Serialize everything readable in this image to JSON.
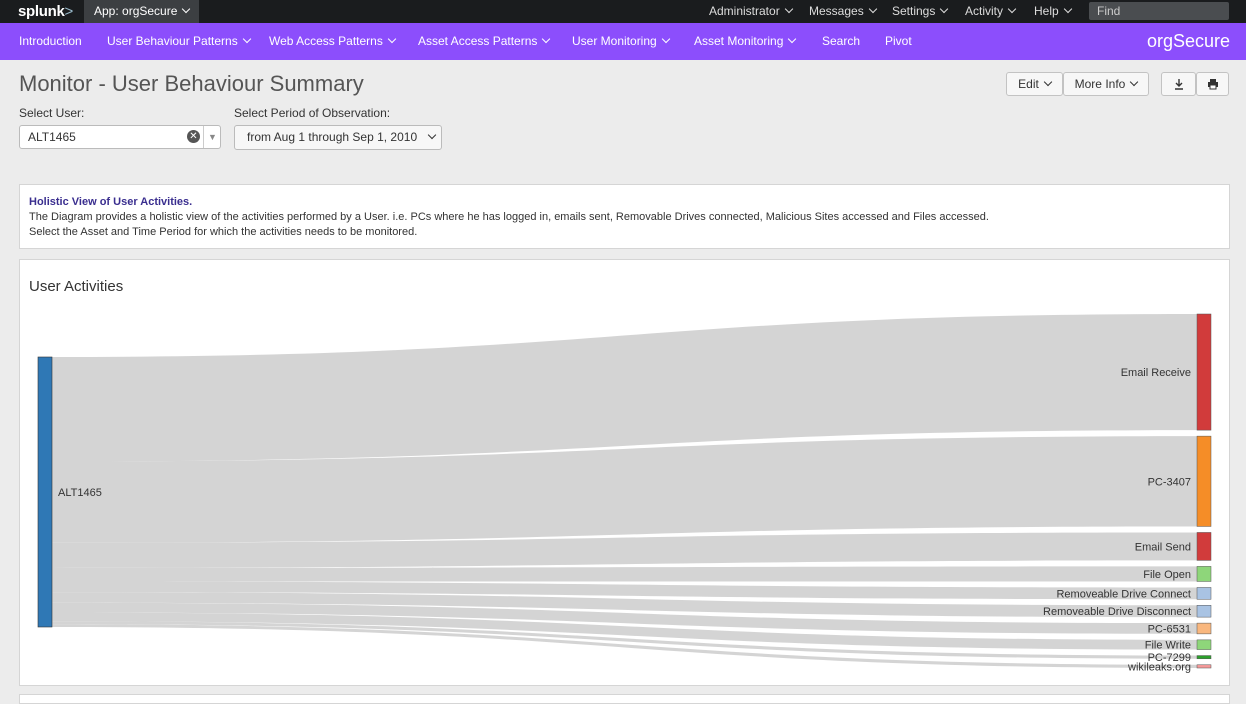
{
  "topbar": {
    "logo": "splunk",
    "logo_suffix": ">",
    "app": "App: orgSecure",
    "nav": [
      "Administrator",
      "Messages",
      "Settings",
      "Activity",
      "Help"
    ],
    "find_placeholder": "Find"
  },
  "appbar": {
    "items": [
      "Introduction",
      "User Behaviour Patterns",
      "Web Access Patterns",
      "Asset Access Patterns",
      "User Monitoring",
      "Asset Monitoring",
      "Search",
      "Pivot"
    ],
    "title": "orgSecure"
  },
  "page": {
    "title": "Monitor - User Behaviour Summary",
    "edit_label": "Edit",
    "more_info_label": "More Info",
    "download_icon": "download-icon",
    "print_icon": "print-icon"
  },
  "inputs": {
    "user_label": "Select User:",
    "user_value": "ALT1465",
    "period_label": "Select Period of Observation:",
    "period_value": "from Aug 1 through Sep 1, 2010"
  },
  "info": {
    "heading": "Holistic View of User Activities.",
    "line1": "The Diagram provides a holistic view of the activities performed by a User. i.e. PCs where he has logged in, emails sent, Removable Drives connected, Malicious Sites accessed and Files accessed.",
    "line2": "Select the Asset and Time Period for which the activities needs to be monitored."
  },
  "chart_data": {
    "type": "sankey",
    "title": "User Activities",
    "source": {
      "name": "ALT1465",
      "color": "#2f78b5"
    },
    "targets": [
      {
        "name": "Email Receive",
        "value": 108,
        "color": "#d13b3b"
      },
      {
        "name": "PC-3407",
        "value": 84,
        "color": "#f58d27"
      },
      {
        "name": "Email Send",
        "value": 26,
        "color": "#d13b3b"
      },
      {
        "name": "File Open",
        "value": 14,
        "color": "#8ed67a"
      },
      {
        "name": "Removeable Drive Connect",
        "value": 11,
        "color": "#a9c3e3"
      },
      {
        "name": "Removeable Drive Disconnect",
        "value": 11,
        "color": "#a9c3e3"
      },
      {
        "name": "PC-6531",
        "value": 10,
        "color": "#f9b77e"
      },
      {
        "name": "File Write",
        "value": 9,
        "color": "#8ed67a"
      },
      {
        "name": "PC-7299",
        "value": 3,
        "color": "#2ca02c"
      },
      {
        "name": "wikileaks.org",
        "value": 3,
        "color": "#f59a9a"
      }
    ]
  }
}
